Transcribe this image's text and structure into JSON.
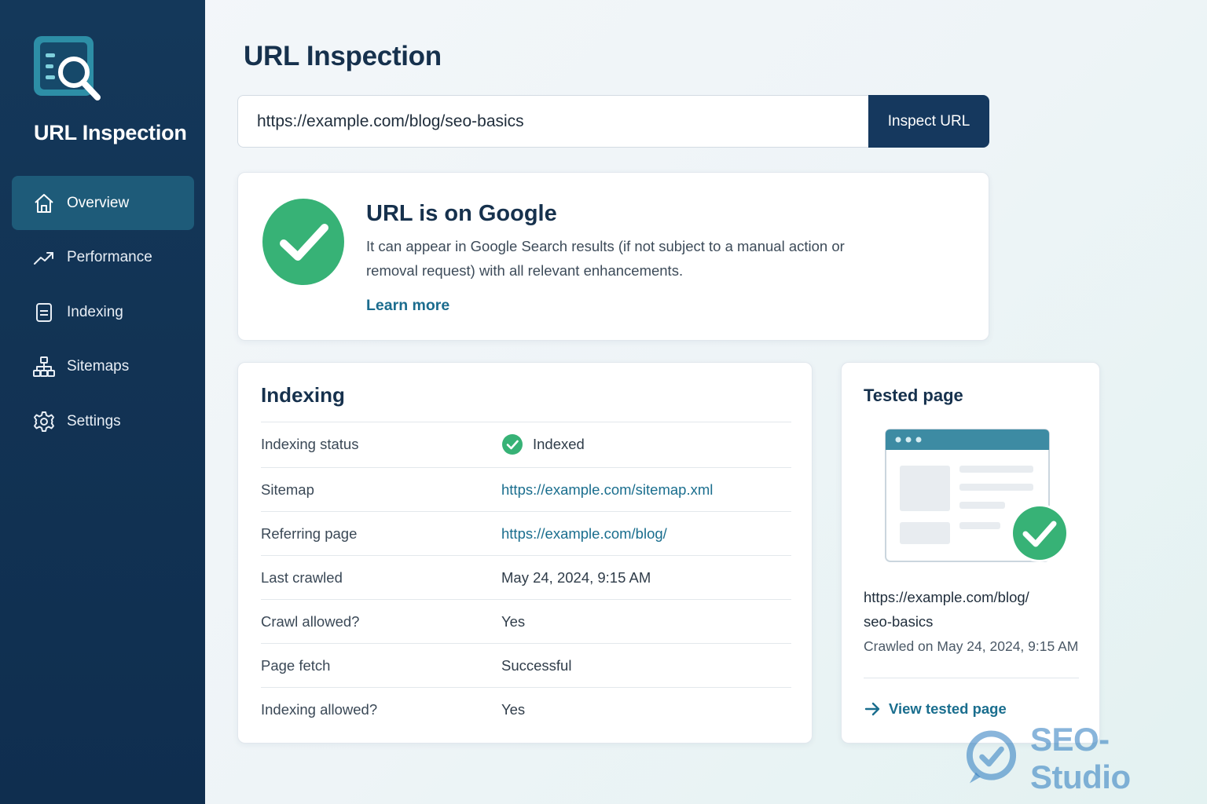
{
  "sidebar": {
    "app_title": "URL Inspection",
    "items": [
      {
        "label": "Overview",
        "icon": "home-icon",
        "active": true
      },
      {
        "label": "Performance",
        "icon": "trend-icon",
        "active": false
      },
      {
        "label": "Indexing",
        "icon": "document-icon",
        "active": false
      },
      {
        "label": "Sitemaps",
        "icon": "sitemap-icon",
        "active": false
      },
      {
        "label": "Settings",
        "icon": "gear-icon",
        "active": false
      }
    ]
  },
  "header": {
    "title": "URL Inspection"
  },
  "search": {
    "value": "https://example.com/blog/seo-basics",
    "button_label": "Inspect URL"
  },
  "status": {
    "title": "URL is on Google",
    "description": "It can appear in Google Search results (if not subject to a manual action or removal request) with all relevant enhancements.",
    "link_label": "Learn more"
  },
  "indexing": {
    "title": "Indexing",
    "rows": [
      {
        "label": "Indexing status",
        "value": "Indexed"
      },
      {
        "label": "Sitemap",
        "value": "https://example.com/sitemap.xml"
      },
      {
        "label": "Referring page",
        "value": "https://example.com/blog/"
      },
      {
        "label": "Last crawled",
        "value": "May 24, 2024, 9:15 AM"
      },
      {
        "label": "Crawl allowed?",
        "value": "Yes"
      },
      {
        "label": "Page fetch",
        "value": "Successful"
      },
      {
        "label": "Indexing allowed?",
        "value": "Yes"
      }
    ]
  },
  "tested_page": {
    "title": "Tested page",
    "url_line1": "https://example.com/blog/",
    "url_line2": "seo-basics",
    "crawled_on": "Crawled on May 24, 2024, 9:15 AM",
    "link_label": "View tested page"
  },
  "watermark": {
    "text": "SEO-Studio"
  },
  "colors": {
    "sidebar_bg": "#14385a",
    "active_item": "#1e5b79",
    "primary_button": "#15385e",
    "success_green": "#37b276",
    "link_teal": "#1a6e8e"
  }
}
